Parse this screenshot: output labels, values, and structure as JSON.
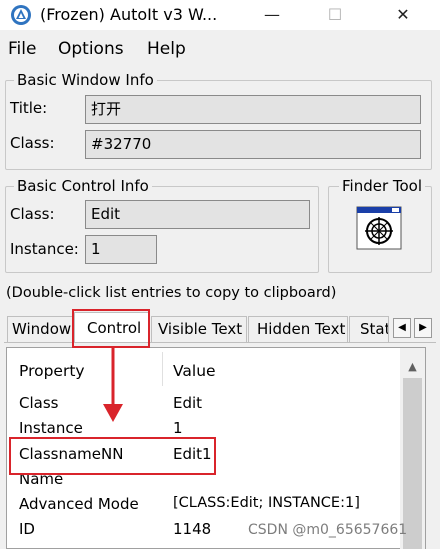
{
  "window": {
    "title": "(Frozen) AutoIt v3 W...",
    "minimize_glyph": "—",
    "maximize_glyph": "☐",
    "close_glyph": "✕"
  },
  "menu": [
    "File",
    "Options",
    "Help"
  ],
  "basic_window_info": {
    "group_label": "Basic Window Info",
    "title_label": "Title:",
    "title_value": "打开",
    "class_label": "Class:",
    "class_value": "#32770"
  },
  "basic_control_info": {
    "group_label": "Basic Control Info",
    "class_label": "Class:",
    "class_value": "Edit",
    "instance_label": "Instance:",
    "instance_value": "1"
  },
  "finder_tool": {
    "group_label": "Finder Tool"
  },
  "hint": "(Double-click list entries to copy to clipboard)",
  "tabs": [
    {
      "label": "Window",
      "active": false
    },
    {
      "label": "Control",
      "active": true
    },
    {
      "label": "Visible Text",
      "active": false
    },
    {
      "label": "Hidden Text",
      "active": false
    },
    {
      "label": "Stat",
      "active": false
    }
  ],
  "tab_scroll": {
    "left": "◀",
    "right": "▶"
  },
  "list": {
    "headers": {
      "property": "Property",
      "value": "Value"
    },
    "scroll_up": "▲",
    "rows": [
      {
        "property": "Class",
        "value": "Edit"
      },
      {
        "property": "Instance",
        "value": "1"
      },
      {
        "property": "ClassnameNN",
        "value": "Edit1"
      },
      {
        "property": "Name",
        "value": ""
      },
      {
        "property": "Advanced Mode",
        "value": "[CLASS:Edit; INSTANCE:1]"
      },
      {
        "property": "ID",
        "value": "1148"
      }
    ]
  },
  "watermark": "CSDN @m0_65657661",
  "colors": {
    "annotation": "#d9242b",
    "accent": "#2f74c0"
  }
}
